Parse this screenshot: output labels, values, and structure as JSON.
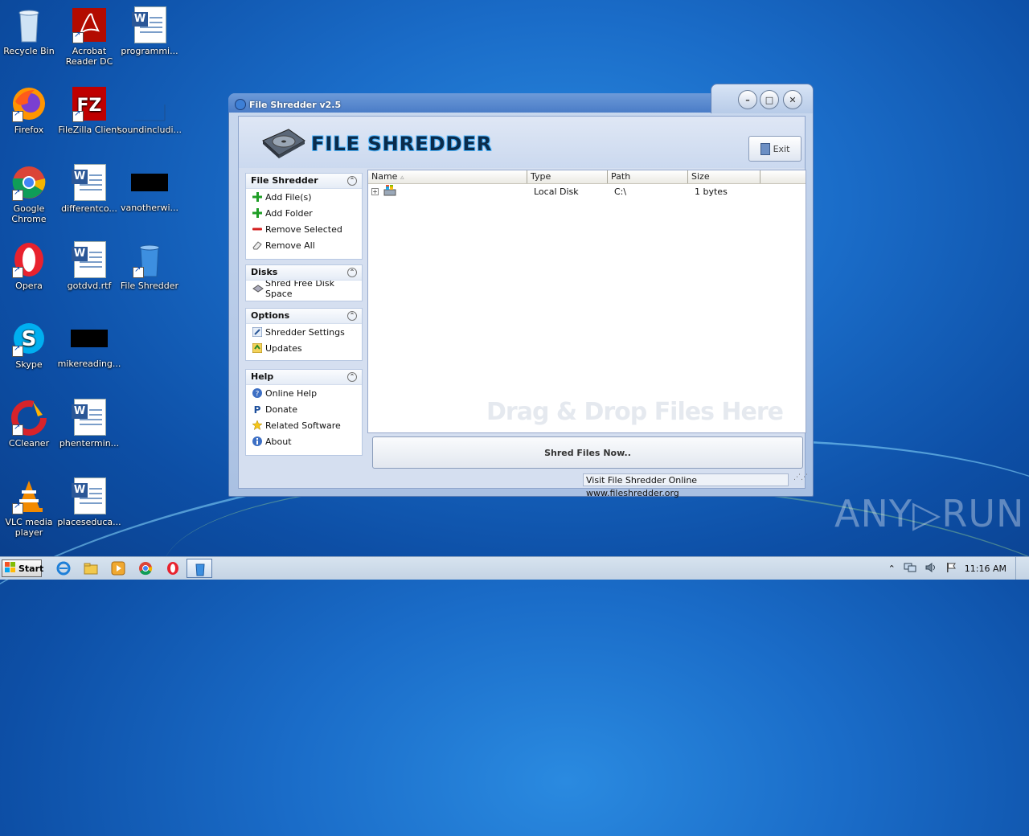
{
  "desktop": {
    "icons": [
      {
        "label": "Recycle Bin"
      },
      {
        "label": "Acrobat Reader DC"
      },
      {
        "label": "programmi..."
      },
      {
        "label": "Firefox"
      },
      {
        "label": "FileZilla Client"
      },
      {
        "label": "soundincludi..."
      },
      {
        "label": "Google Chrome"
      },
      {
        "label": "differentco..."
      },
      {
        "label": "vanotherwi..."
      },
      {
        "label": "Opera"
      },
      {
        "label": "gotdvd.rtf"
      },
      {
        "label": "File Shredder"
      },
      {
        "label": "Skype"
      },
      {
        "label": "mikereading..."
      },
      {
        "label": "CCleaner"
      },
      {
        "label": "phentermin..."
      },
      {
        "label": "VLC media player"
      },
      {
        "label": "placeseduca..."
      }
    ]
  },
  "window": {
    "title": "File Shredder v2.5",
    "logo_text": "FILE SHREDDER",
    "exit_label": "Exit",
    "panels": {
      "file_shredder": {
        "title": "File Shredder",
        "items": [
          "Add File(s)",
          "Add Folder",
          "Remove Selected",
          "Remove All"
        ]
      },
      "disks": {
        "title": "Disks",
        "items": [
          "Shred Free Disk Space"
        ]
      },
      "options": {
        "title": "Options",
        "items": [
          "Shredder Settings",
          "Updates"
        ]
      },
      "help": {
        "title": "Help",
        "items": [
          "Online Help",
          "Donate",
          "Related Software",
          "About"
        ]
      }
    },
    "list": {
      "columns": [
        "Name",
        "Type",
        "Path",
        "Size"
      ],
      "rows": [
        {
          "name": "",
          "type": "Local Disk",
          "path": "C:\\",
          "size": "1 bytes"
        }
      ],
      "drop_hint": "Drag & Drop Files Here"
    },
    "shred_button": "Shred Files Now..",
    "status_link": "Visit File Shredder Online   www.fileshredder.org"
  },
  "taskbar": {
    "start_label": "Start",
    "clock": "11:16 AM"
  },
  "watermark": "ANY▷RUN"
}
